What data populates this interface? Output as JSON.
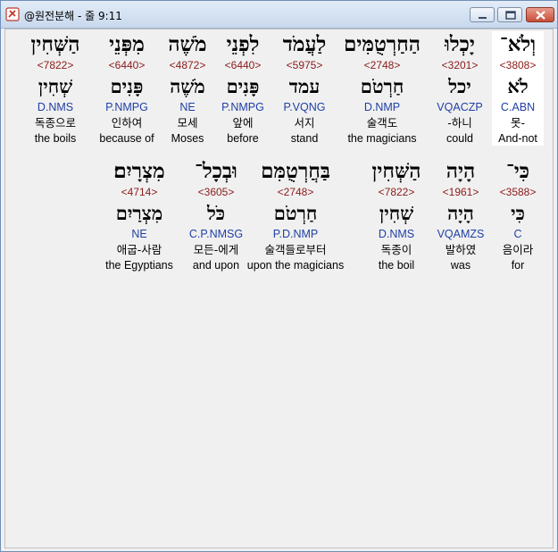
{
  "window": {
    "title": "@원전분해 - 줄 9:11"
  },
  "colors": {
    "strong": "#8b1a1a",
    "morph": "#1f3fa6",
    "selected_bg": "#ffffff"
  },
  "rows": [
    {
      "words": [
        {
          "heb": "וְלֹא־",
          "strong": "<3808>",
          "lex": "לֹא",
          "morph": "C.ABN",
          "kor": "못-",
          "eng": "And-not",
          "selected": true
        },
        {
          "heb": "יָכְלוּ",
          "strong": "<3201>",
          "lex": "יכל",
          "morph": "VQACZP",
          "kor": "-하니",
          "eng": "could"
        },
        {
          "heb": "הַחַרְטֻמִּים",
          "strong": "<2748>",
          "lex": "חַרְטֹם",
          "morph": "D.NMP",
          "kor": "술객도",
          "eng": "the magicians"
        },
        {
          "heb": "לַעֲמֹד",
          "strong": "<5975>",
          "lex": "עמד",
          "morph": "P.VQNG",
          "kor": "서지",
          "eng": "stand"
        },
        {
          "heb": "לִפְנֵי",
          "strong": "<6440>",
          "lex": "פָּנִים",
          "morph": "P.NMPG",
          "kor": "앞에",
          "eng": "before"
        },
        {
          "heb": "מֹשֶׁה",
          "strong": "<4872>",
          "lex": "מֹשֶׁה",
          "morph": "NE",
          "kor": "모세",
          "eng": "Moses"
        },
        {
          "heb": "מִפְּנֵי",
          "strong": "<6440>",
          "lex": "פָּנִים",
          "morph": "P.NMPG",
          "kor": "인하여",
          "eng": "because of"
        },
        {
          "heb": "הַשְּׁחִין",
          "strong": "<7822>",
          "lex": "שְׁחִין",
          "morph": "D.NMS",
          "kor": "독종으로",
          "eng": "the boils"
        }
      ]
    },
    {
      "words": [
        {
          "heb": "כִּי־",
          "strong": "<3588>",
          "lex": "כִּי",
          "morph": "C",
          "kor": "음이라",
          "eng": "for"
        },
        {
          "heb": "הָיָה",
          "strong": "<1961>",
          "lex": "הָיָה",
          "morph": "VQAMZS",
          "kor": "발하였",
          "eng": "was"
        },
        {
          "heb": "הַשְּׁחִין",
          "strong": "<7822>",
          "lex": "שְׁחִין",
          "morph": "D.NMS",
          "kor": "독종이",
          "eng": "the boil"
        },
        {
          "heb": "בַּחֲרְטֻמִּם",
          "strong": "<2748>",
          "lex": "חַרְטֹם",
          "morph": "P.D.NMP",
          "kor": "술객들로부터",
          "eng": "upon the magicians"
        },
        {
          "heb": "וּבְכָל־",
          "strong": "<3605>",
          "lex": "כֹּל",
          "morph": "C.P.NMSG",
          "kor": "모든-에게",
          "eng": "and upon"
        },
        {
          "heb": "מִצְרָיִם׃",
          "strong": "<4714>",
          "lex": "מִצְרַיִם",
          "morph": "NE",
          "kor": "애굽-사람",
          "eng": "the Egyptians"
        }
      ]
    }
  ]
}
